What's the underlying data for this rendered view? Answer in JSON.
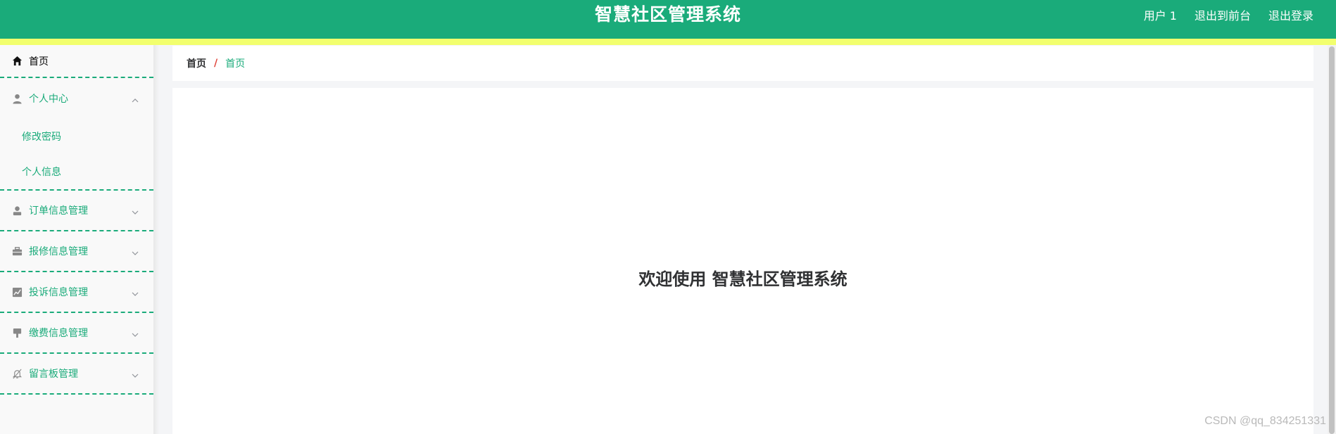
{
  "header": {
    "title": "智慧社区管理系统",
    "user": "用户 1",
    "to_front": "退出到前台",
    "logout": "退出登录",
    "bg_color": "#1aab7a",
    "stripe_color": "#f2ff6e"
  },
  "sidebar": {
    "home": {
      "label": "首页",
      "icon": "home-icon"
    },
    "personal": {
      "label": "个人中心",
      "icon": "user-icon",
      "expanded": true,
      "children": [
        "修改密码",
        "个人信息"
      ]
    },
    "items": [
      {
        "label": "订单信息管理",
        "icon": "user-solid-icon"
      },
      {
        "label": "报修信息管理",
        "icon": "briefcase-icon"
      },
      {
        "label": "投诉信息管理",
        "icon": "chart-icon"
      },
      {
        "label": "缴费信息管理",
        "icon": "brush-icon"
      },
      {
        "label": "留言板管理",
        "icon": "bell-off-icon"
      }
    ]
  },
  "breadcrumb": {
    "root": "首页",
    "separator": "/",
    "current": "首页"
  },
  "main": {
    "welcome": "欢迎使用 智慧社区管理系统"
  },
  "watermark": "CSDN @qq_834251331"
}
